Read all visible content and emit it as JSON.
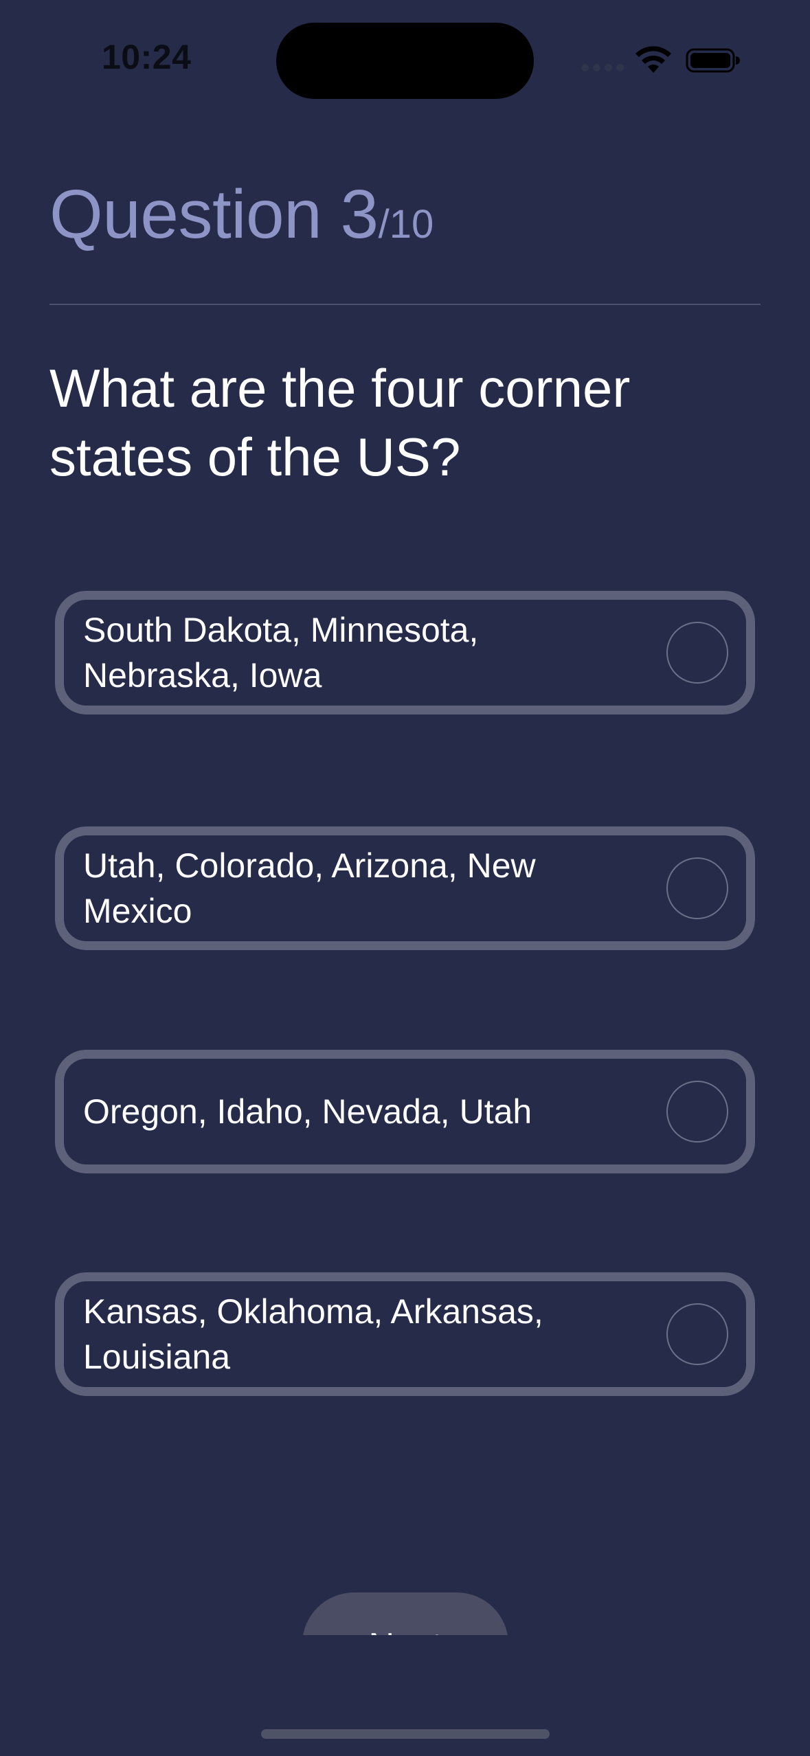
{
  "status_bar": {
    "time": "10:24",
    "icons": [
      "cellular-signal-icon",
      "wifi-icon",
      "battery-icon"
    ]
  },
  "header": {
    "question_label": "Question 3",
    "question_total": "/10"
  },
  "question": {
    "text": "What are the four corner states of the US?"
  },
  "options": [
    {
      "label": "South Dakota, Minnesota, Nebraska, Iowa",
      "selected": false
    },
    {
      "label": "Utah, Colorado, Arizona, New Mexico",
      "selected": false
    },
    {
      "label": "Oregon, Idaho, Nevada, Utah",
      "selected": false
    },
    {
      "label": "Kansas, Oklahoma, Arkansas, Louisiana",
      "selected": false
    }
  ],
  "footer": {
    "next_label": "Next"
  },
  "colors": {
    "background": "#252b48",
    "header_text": "#8e95c6",
    "option_border": "#5d6179",
    "button": "#4a4d63"
  }
}
